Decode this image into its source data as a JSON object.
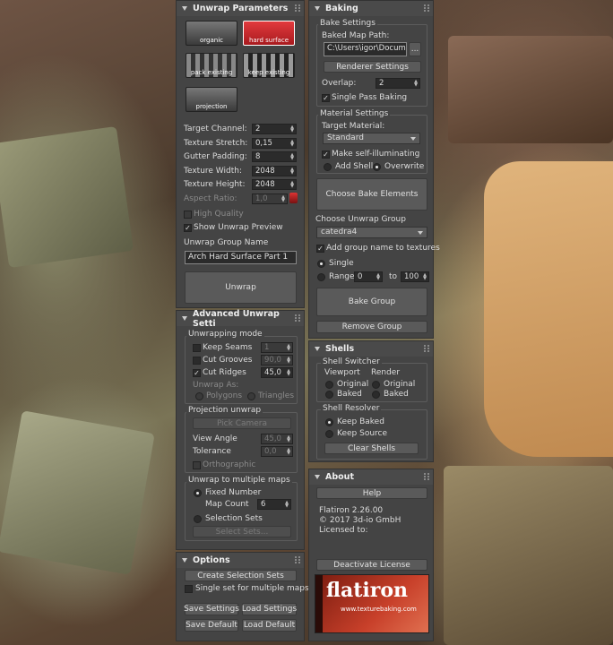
{
  "unwrap_params": {
    "title": "Unwrap Parameters",
    "icons": {
      "organic": "organic",
      "hard": "hard surface",
      "pack": "pack existing",
      "keep": "keep existing",
      "projection": "projection"
    },
    "target_channel": {
      "label": "Target Channel:",
      "value": "2"
    },
    "texture_stretch": {
      "label": "Texture Stretch:",
      "value": "0,15"
    },
    "gutter_padding": {
      "label": "Gutter Padding:",
      "value": "8"
    },
    "texture_width": {
      "label": "Texture Width:",
      "value": "2048"
    },
    "texture_height": {
      "label": "Texture Height:",
      "value": "2048"
    },
    "aspect_ratio": {
      "label": "Aspect Ratio:",
      "value": "1,0"
    },
    "high_quality": "High Quality",
    "show_preview": "Show Unwrap Preview",
    "group_name_label": "Unwrap Group Name",
    "group_name_value": "Arch Hard Surface Part 1",
    "unwrap_btn": "Unwrap"
  },
  "advanced": {
    "title": "Advanced Unwrap Setti",
    "mode_group": "Unwrapping mode",
    "keep_seams": {
      "label": "Keep Seams",
      "value": "1"
    },
    "cut_grooves": {
      "label": "Cut Grooves",
      "value": "90,0"
    },
    "cut_ridges": {
      "label": "Cut Ridges",
      "value": "45,0"
    },
    "unwrap_as": "Unwrap As:",
    "polygons": "Polygons",
    "triangles": "Triangles",
    "proj_group": "Projection unwrap",
    "pick_camera": "Pick Camera",
    "view_angle": {
      "label": "View Angle",
      "value": "45,0"
    },
    "tolerance": {
      "label": "Tolerance",
      "value": "0,0"
    },
    "orthographic": "Orthographic",
    "multi_group": "Unwrap to multiple maps",
    "fixed_number": "Fixed Number",
    "map_count": {
      "label": "Map Count",
      "value": "6"
    },
    "selection_sets": "Selection Sets",
    "select_sets_btn": "Select Sets..."
  },
  "options": {
    "title": "Options",
    "create_sel": "Create Selection Sets",
    "single_set": "Single set for multiple maps",
    "save_settings": "Save Settings",
    "load_settings": "Load Settings",
    "save_default": "Save Default",
    "load_default": "Load Default"
  },
  "baking": {
    "title": "Baking",
    "bake_settings": "Bake Settings",
    "map_path_label": "Baked Map Path:",
    "map_path": "C:\\Users\\igor\\Documen",
    "browse": "...",
    "renderer_btn": "Renderer Settings",
    "overlap": {
      "label": "Overlap:",
      "value": "2"
    },
    "single_pass": "Single Pass Baking",
    "material_settings": "Material Settings",
    "target_material_label": "Target Material:",
    "target_material": "Standard",
    "self_illum": "Make self-illuminating",
    "add_shell": "Add Shell",
    "overwrite": "Overwrite",
    "choose_elements": "Choose Bake Elements",
    "choose_group": "Choose Unwrap Group",
    "group_value": "catedra4",
    "add_group_name": "Add group name to textures",
    "single": "Single",
    "range": "Range",
    "range_from": "0",
    "range_to_label": "to",
    "range_to": "100",
    "bake_group": "Bake Group",
    "remove_group": "Remove Group"
  },
  "shells": {
    "title": "Shells",
    "switcher": "Shell Switcher",
    "viewport": "Viewport",
    "render": "Render",
    "original": "Original",
    "baked": "Baked",
    "resolver": "Shell Resolver",
    "keep_baked": "Keep Baked",
    "keep_source": "Keep Source",
    "clear": "Clear Shells"
  },
  "about": {
    "title": "About",
    "help": "Help",
    "version": "Flatiron 2.26.00",
    "copyright": "© 2017 3d-io GmbH",
    "licensed": "Licensed to:",
    "deactivate": "Deactivate License",
    "logo_text": "flatiron",
    "logo_url": "www.texturebaking.com"
  },
  "colors": {
    "panel": "#444444",
    "accent_red": "#c8282c",
    "input": "#2b2b2b"
  }
}
